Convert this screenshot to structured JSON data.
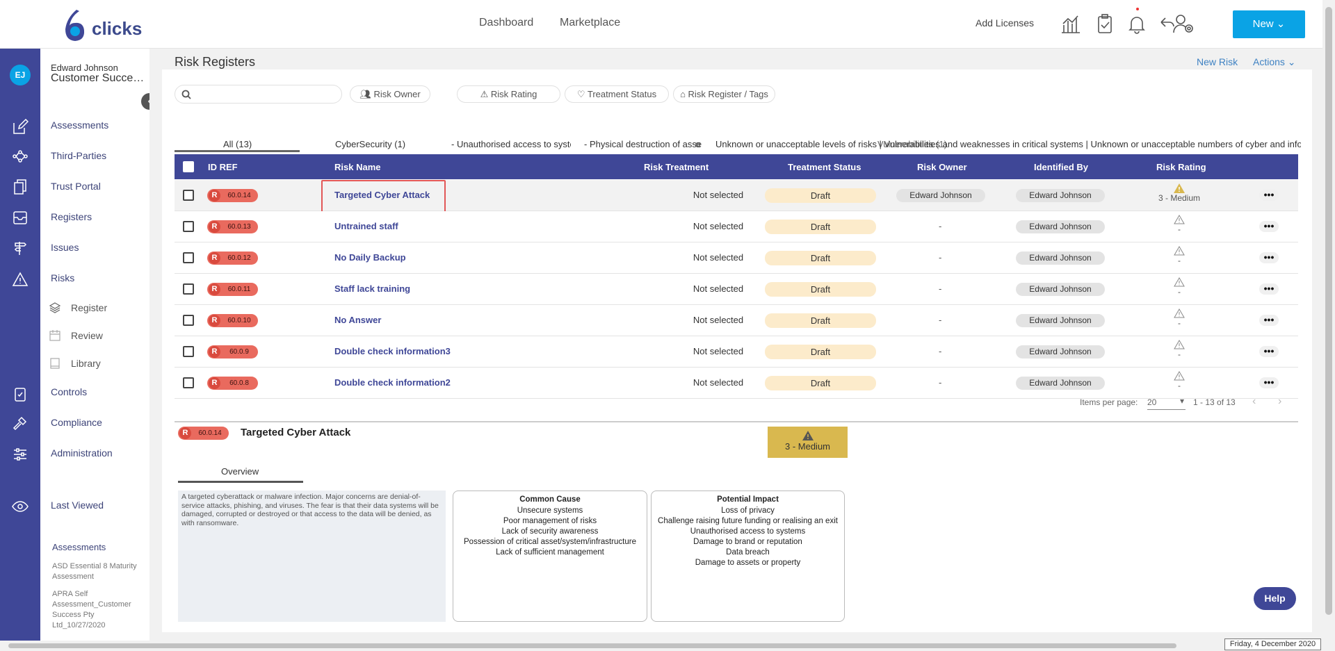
{
  "brand": {
    "name": "clicks",
    "color": "#3f4797"
  },
  "topnav": {
    "dashboard": "Dashboard",
    "marketplace": "Marketplace",
    "add_licenses": "Add Licenses",
    "new_button": "New"
  },
  "user": {
    "initials": "EJ",
    "name": "Edward Johnson",
    "org": "Customer Success Pty Ltd"
  },
  "sidebar": {
    "items": [
      {
        "label": "Assessments",
        "icon": "pencil-square-icon"
      },
      {
        "label": "Third-Parties",
        "icon": "network-icon"
      },
      {
        "label": "Trust Portal",
        "icon": "documents-icon"
      },
      {
        "label": "Registers",
        "icon": "inbox-icon"
      },
      {
        "label": "Issues",
        "icon": "signpost-icon"
      },
      {
        "label": "Risks",
        "icon": "warning-icon"
      }
    ],
    "risk_sub": [
      {
        "label": "Register"
      },
      {
        "label": "Review"
      },
      {
        "label": "Library"
      }
    ],
    "items2": [
      {
        "label": "Controls"
      },
      {
        "label": "Compliance"
      },
      {
        "label": "Administration"
      }
    ],
    "last_viewed": "Last Viewed",
    "recent_heading": "Assessments",
    "recent_items": [
      "ASD Essential 8 Maturity Assessment",
      "APRA Self Assessment_Customer Success Pty Ltd_10/27/2020"
    ]
  },
  "page": {
    "title": "Risk Registers",
    "new_risk": "New Risk",
    "actions": "Actions"
  },
  "filters": [
    "Risk Owner",
    "Risk Rating",
    "Treatment Status",
    "Risk Register / Tags"
  ],
  "search": {
    "placeholder": ""
  },
  "tabs": [
    "All (13)",
    "CyberSecurity (1)",
    "- Unauthorised access to syste",
    "- Physical destruction of asse",
    "Unknown or unacceptable levels of risks | Vulnerabilities and weaknesses in critical systems | Unknown or unacceptable numbers of cyber and information"
  ],
  "tab_overlap": [
    "o",
    "Vulnerabilities (1)"
  ],
  "table": {
    "headers": [
      "ID REF",
      "Risk Name",
      "Risk Treatment",
      "Treatment Status",
      "Risk Owner",
      "Identified By",
      "Risk Rating"
    ],
    "rows": [
      {
        "badge": "R",
        "id": "60.0.14",
        "name": "Targeted Cyber Attack",
        "treatment": "Not selected",
        "status": "Draft",
        "owner": "Edward Johnson",
        "identified": "Edward Johnson",
        "rating": "3 - Medium"
      },
      {
        "badge": "R",
        "id": "60.0.13",
        "name": "Untrained staff",
        "treatment": "Not selected",
        "status": "Draft",
        "owner": "-",
        "identified": "Edward Johnson",
        "rating": "-"
      },
      {
        "badge": "R",
        "id": "60.0.12",
        "name": "No Daily Backup",
        "treatment": "Not selected",
        "status": "Draft",
        "owner": "-",
        "identified": "Edward Johnson",
        "rating": "-"
      },
      {
        "badge": "R",
        "id": "60.0.11",
        "name": "Staff lack training",
        "treatment": "Not selected",
        "status": "Draft",
        "owner": "-",
        "identified": "Edward Johnson",
        "rating": "-"
      },
      {
        "badge": "R",
        "id": "60.0.10",
        "name": "No Answer",
        "treatment": "Not selected",
        "status": "Draft",
        "owner": "-",
        "identified": "Edward Johnson",
        "rating": "-"
      },
      {
        "badge": "R",
        "id": "60.0.9",
        "name": "Double check information3",
        "treatment": "Not selected",
        "status": "Draft",
        "owner": "-",
        "identified": "Edward Johnson",
        "rating": "-"
      },
      {
        "badge": "R",
        "id": "60.0.8",
        "name": "Double check information2",
        "treatment": "Not selected",
        "status": "Draft",
        "owner": "-",
        "identified": "Edward Johnson",
        "rating": "-"
      }
    ]
  },
  "pagination": {
    "label": "Items per page:",
    "per_page": "20",
    "range": "1 - 13 of 13"
  },
  "detail": {
    "badge": "R",
    "id": "60.0.14",
    "title": "Targeted Cyber Attack",
    "rating": "3 - Medium",
    "tab": "Overview",
    "description": "A targeted cyberattack or malware infection. Major concerns are denial-of-service attacks, phishing, and viruses. The fear is that their data systems will be damaged, corrupted or destroyed or that access to the data will be denied, as with ransomware.",
    "common_cause": {
      "title": "Common Cause",
      "items": [
        "Unsecure systems",
        "Poor management of risks",
        "Lack of security awareness",
        "Possession of critical asset/system/infrastructure",
        "Lack of sufficient management"
      ]
    },
    "potential_impact": {
      "title": "Potential Impact",
      "items": [
        "Loss of privacy",
        "Challenge raising future funding or realising an exit",
        "Unauthorised access to systems",
        "Damage to brand or reputation",
        "Data breach",
        "Damage to assets or property"
      ]
    }
  },
  "help": "Help",
  "date": "Friday, 4 December 2020",
  "colors": {
    "accent": "#0aa3e5",
    "nav": "#3f4797",
    "draft": "#fcebcb",
    "badge": "#e96a5e",
    "medium": "#d9b84f"
  }
}
